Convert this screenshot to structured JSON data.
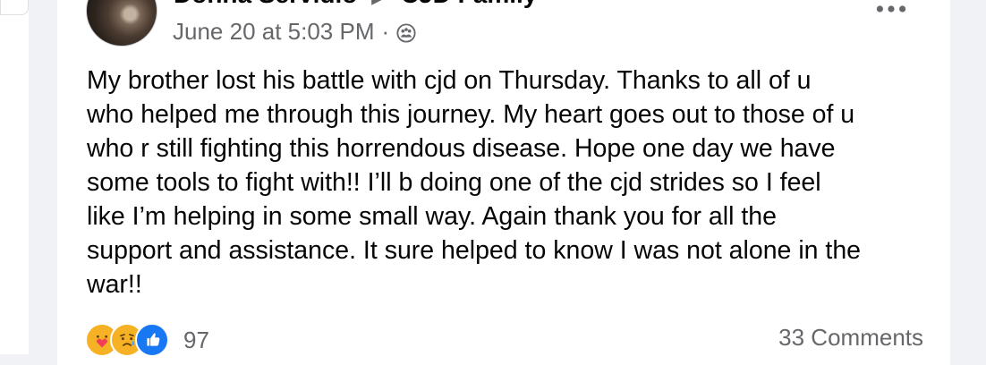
{
  "post": {
    "author": "Donna Servidio",
    "group": "CJD Family",
    "timestamp": "June 20 at 5:03 PM",
    "separator": "·",
    "audience_icon": "group-audience-icon",
    "more_icon": "more-options-icon",
    "text_lines": [
      "My brother lost his battle with cjd on Thursday. Thanks to all of u",
      "who helped me through this journey. My heart goes out to those of u",
      "who r still fighting this horrendous disease. Hope one day we have",
      "some tools to fight with!! I’ll b doing one of the cjd strides so I feel",
      "like I’m helping in some small way. Again thank you for all the",
      "support and assistance. It sure helped to know I was not alone in the",
      "war!!"
    ]
  },
  "reactions": {
    "icons": [
      "care-reaction-icon",
      "sad-reaction-icon",
      "like-reaction-icon"
    ],
    "count": "97",
    "colors": {
      "care": "#f7b125",
      "sad": "#f7b125",
      "like": "#1877f2"
    }
  },
  "comments": {
    "label": "33 Comments"
  },
  "colors": {
    "text_primary": "#050505",
    "text_secondary": "#65676b",
    "card": "#ffffff",
    "page": "#f0f2f5"
  }
}
